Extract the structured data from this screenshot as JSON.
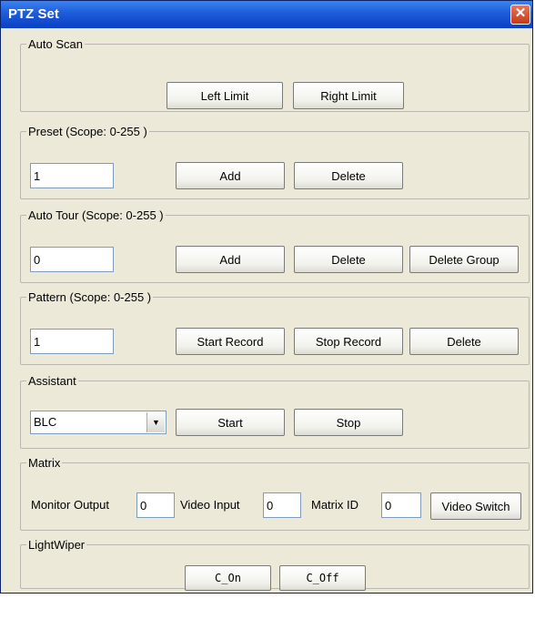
{
  "window": {
    "title": "PTZ Set",
    "close_glyph": "✕"
  },
  "auto_scan": {
    "title": "Auto Scan",
    "left_limit": "Left Limit",
    "right_limit": "Right Limit"
  },
  "preset": {
    "title": "Preset (Scope: 0-255 )",
    "value": "1",
    "add": "Add",
    "delete": "Delete"
  },
  "auto_tour": {
    "title": "Auto Tour (Scope: 0-255 )",
    "value": "0",
    "add": "Add",
    "delete": "Delete",
    "delete_group": "Delete Group"
  },
  "pattern": {
    "title": "Pattern (Scope: 0-255 )",
    "value": "1",
    "start_record": "Start Record",
    "stop_record": "Stop Record",
    "delete": "Delete"
  },
  "assistant": {
    "title": "Assistant",
    "selected": "BLC",
    "start": "Start",
    "stop": "Stop",
    "dropdown_icon": "chevron-down-icon"
  },
  "matrix": {
    "title": "Matrix",
    "monitor_output_label": "Monitor Output",
    "monitor_output_value": "0",
    "video_input_label": "Video Input",
    "video_input_value": "0",
    "matrix_id_label": "Matrix ID",
    "matrix_id_value": "0",
    "video_switch": "Video Switch"
  },
  "light_wiper": {
    "title": "LightWiper",
    "on": "C_On",
    "off": "C_Off"
  },
  "colors": {
    "titlebar": "#1f5fdc",
    "background": "#ece9d8",
    "close": "#c33a19"
  }
}
